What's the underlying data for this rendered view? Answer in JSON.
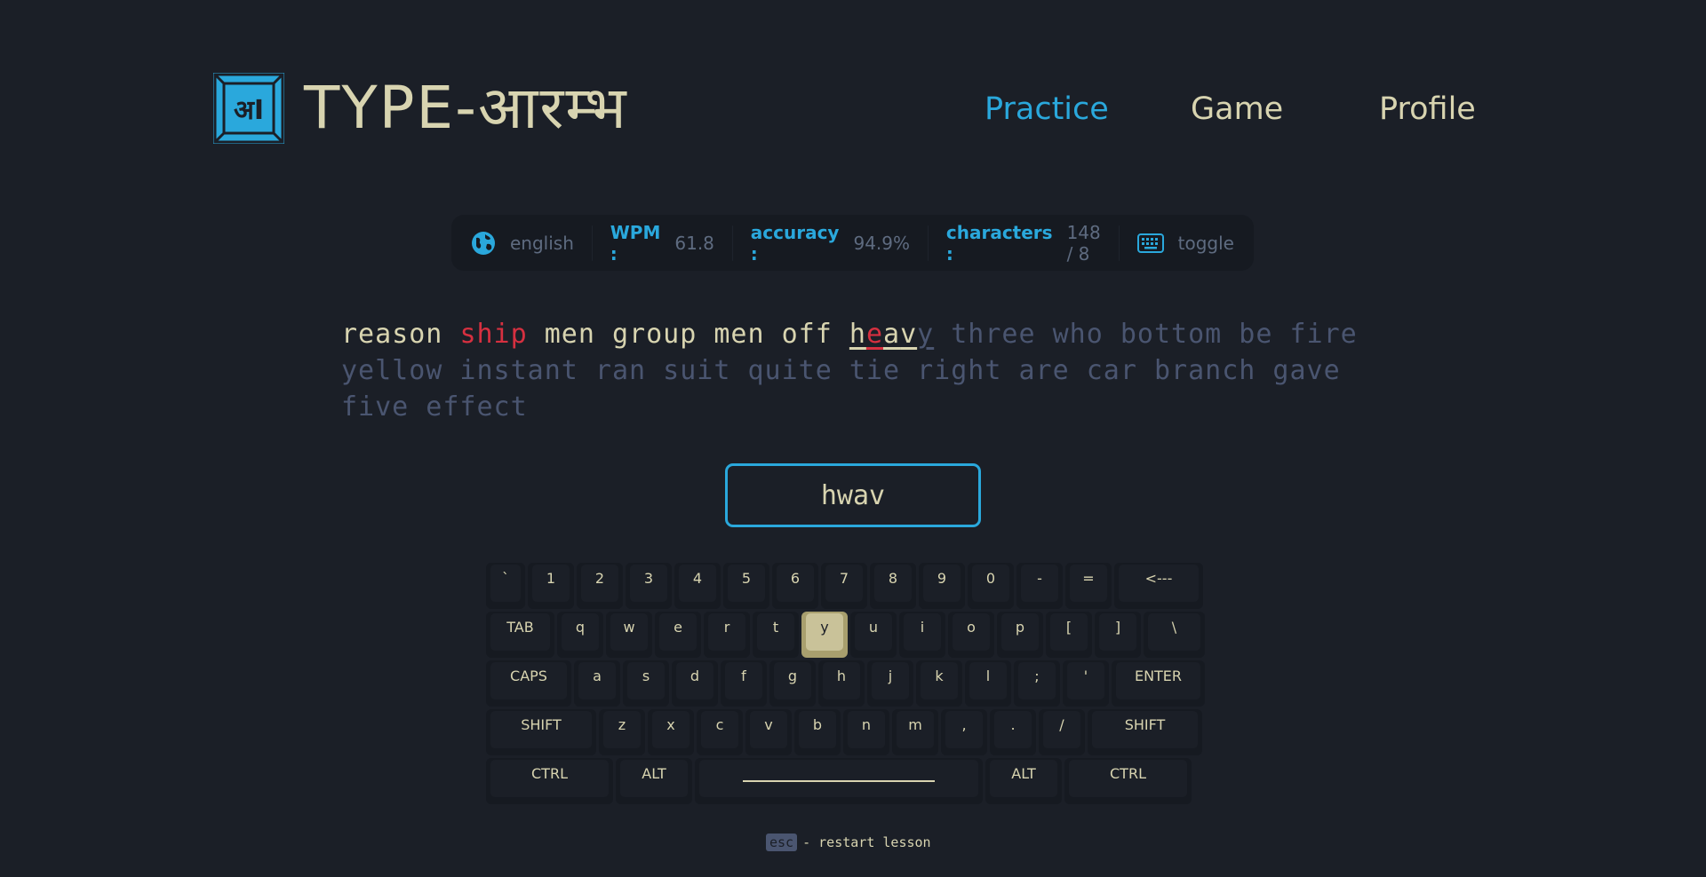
{
  "header": {
    "logo_glyph": "अI",
    "logo_text": "TYPE-आरम्भ",
    "nav": [
      {
        "label": "Practice",
        "active": true
      },
      {
        "label": "Game",
        "active": false
      },
      {
        "label": "Profile",
        "active": false
      }
    ]
  },
  "stats": {
    "language": "english",
    "wpm_label": "WPM :",
    "wpm_value": "61.8",
    "accuracy_label": "accuracy :",
    "accuracy_value": "94.9%",
    "characters_label": "characters :",
    "characters_value": "148 / 8",
    "toggle_label": "toggle",
    "accent_color": "#2aa8dc"
  },
  "lesson": {
    "typed_words": [
      "reason",
      "ship",
      "men",
      "group",
      "men",
      "off"
    ],
    "error_words": [
      "ship"
    ],
    "current_word_chars": [
      {
        "ch": "h",
        "state": "correct"
      },
      {
        "ch": "e",
        "state": "incorrect"
      },
      {
        "ch": "a",
        "state": "correct"
      },
      {
        "ch": "v",
        "state": "correct"
      },
      {
        "ch": "y",
        "state": "next"
      }
    ],
    "upcoming": "three who bottom be fire yellow instant ran suit quite tie right are car branch gave five effect"
  },
  "input": {
    "value": "hwav"
  },
  "keyboard": {
    "highlight_key": "y",
    "rows": [
      [
        "`",
        "1",
        "2",
        "3",
        "4",
        "5",
        "6",
        "7",
        "8",
        "9",
        "0",
        "-",
        "=",
        "<---"
      ],
      [
        "TAB",
        "q",
        "w",
        "e",
        "r",
        "t",
        "y",
        "u",
        "i",
        "o",
        "p",
        "[",
        "]",
        "\\"
      ],
      [
        "CAPS",
        "a",
        "s",
        "d",
        "f",
        "g",
        "h",
        "j",
        "k",
        "l",
        ";",
        "'",
        "ENTER"
      ],
      [
        "SHIFT",
        "z",
        "x",
        "c",
        "v",
        "b",
        "n",
        "m",
        ",",
        ".",
        "/",
        "SHIFT"
      ],
      [
        "CTRL",
        "ALT",
        "",
        "ALT",
        "CTRL"
      ]
    ]
  },
  "footer": {
    "key": "esc",
    "text": "- restart lesson"
  }
}
